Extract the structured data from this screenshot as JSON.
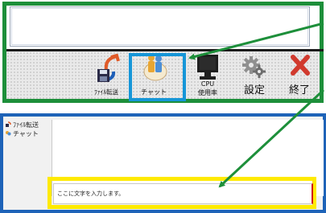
{
  "toolbar": {
    "transfer_label": "ﾌｧｲﾙ転送",
    "chat_label": "チャット",
    "cpu_label": "CPU",
    "cpu_sub_label": "使用率",
    "settings_label": "設定",
    "exit_label": "終了"
  },
  "sidebar": {
    "items": [
      {
        "label": "ﾌｧｲﾙ転送",
        "icon": "file-transfer-icon"
      },
      {
        "label": "チャット",
        "icon": "chat-icon"
      }
    ]
  },
  "chat": {
    "input_text": "ここに文字を入力します。"
  },
  "colors": {
    "highlight_green": "#1d8f3a",
    "highlight_blue": "#1696d8",
    "panel_border_blue": "#1e63b8",
    "highlight_yellow": "#ffea00"
  }
}
